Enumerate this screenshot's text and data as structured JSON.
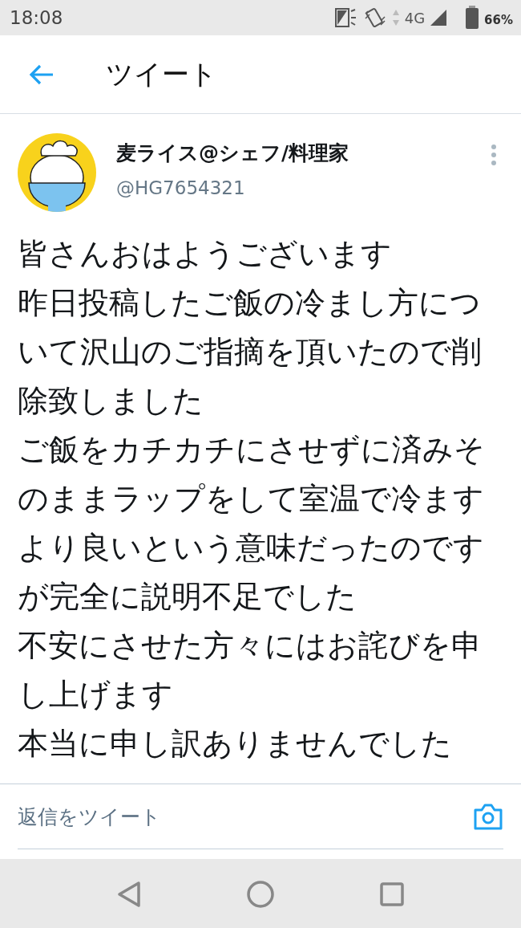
{
  "status_bar": {
    "time": "18:08",
    "network": "4G",
    "battery": "66%"
  },
  "header": {
    "title": "ツイート"
  },
  "tweet": {
    "name": "麦ライス@シェフ/料理家",
    "handle": "@HG7654321",
    "lines": [
      "皆さんおはようございます",
      "昨日投稿したご飯の冷まし方につ",
      "いて沢山のご指摘を頂いたので削",
      "除致しました",
      "ご飯をカチカチにさせずに済みそ",
      "のままラップをして室温で冷ます",
      "より良いという意味だったのです",
      "が完全に説明不足でした",
      "不安にさせた方々にはお詫びを申",
      "し上げます",
      "本当に申し訳ありませんでした"
    ]
  },
  "reply": {
    "placeholder": "返信をツイート"
  }
}
